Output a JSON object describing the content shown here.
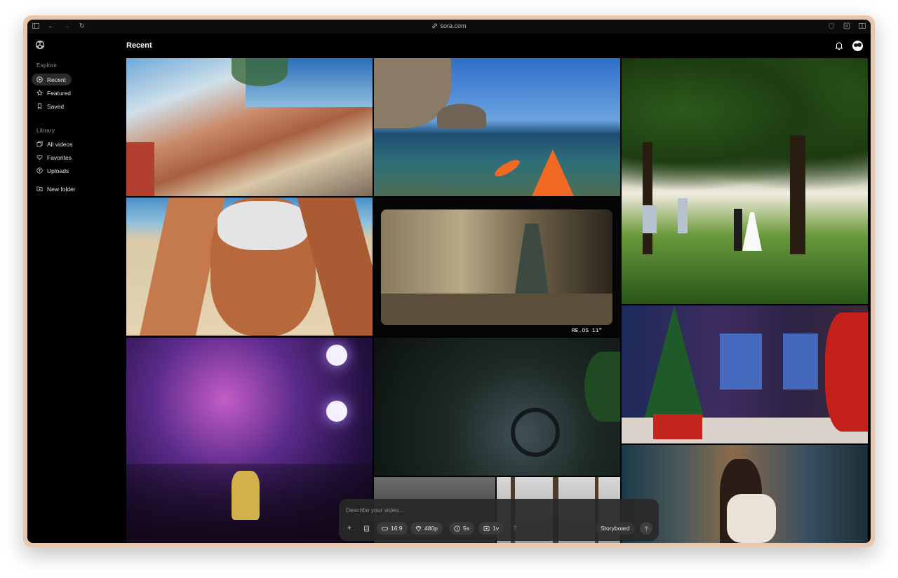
{
  "browser": {
    "url": "sora.com"
  },
  "sidebar": {
    "explore_label": "Explore",
    "explore_items": [
      {
        "label": "Recent",
        "icon": "play-circle-icon"
      },
      {
        "label": "Featured",
        "icon": "star-icon"
      },
      {
        "label": "Saved",
        "icon": "bookmark-icon"
      }
    ],
    "library_label": "Library",
    "library_items": [
      {
        "label": "All videos",
        "icon": "videos-icon"
      },
      {
        "label": "Favorites",
        "icon": "heart-icon"
      },
      {
        "label": "Uploads",
        "icon": "upload-icon"
      }
    ],
    "new_folder_label": "New folder"
  },
  "main": {
    "title": "Recent",
    "tile_overlay_text": "RE.OS  11\""
  },
  "prompt": {
    "placeholder": "Describe your video...",
    "aspect": "16:9",
    "resolution": "480p",
    "duration": "5s",
    "variations": "1v",
    "help": "?",
    "storyboard": "Storyboard"
  },
  "colors": {
    "accent": "#ffffff",
    "window_bg": "#000000",
    "frame": "#e8c9b0"
  }
}
